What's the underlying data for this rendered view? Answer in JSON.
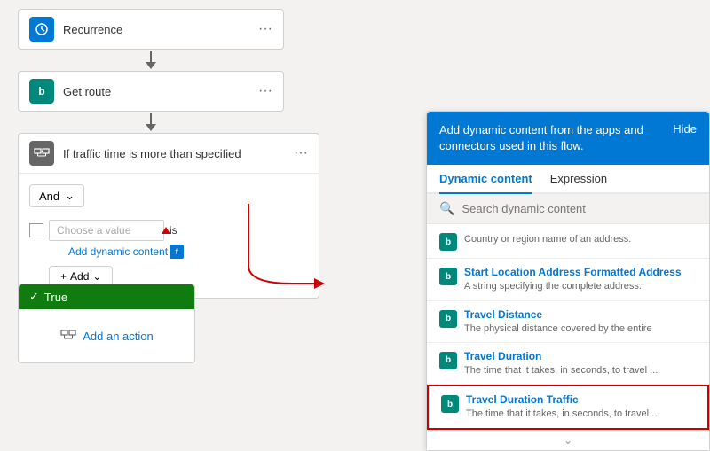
{
  "flow": {
    "blocks": [
      {
        "id": "recurrence",
        "title": "Recurrence",
        "iconType": "clock",
        "iconColor": "#0078d4"
      },
      {
        "id": "get-route",
        "title": "Get route",
        "iconType": "bing",
        "iconColor": "#00897b"
      },
      {
        "id": "condition",
        "title": "If traffic time is more than specified",
        "iconType": "condition",
        "iconColor": "#666"
      }
    ],
    "condition": {
      "and_label": "And",
      "choose_value_placeholder": "Choose a value",
      "is_label": "is",
      "add_dynamic_label": "Add dynamic content",
      "add_label": "Add"
    },
    "true_block": {
      "label": "True",
      "add_action_label": "Add an action"
    }
  },
  "dynamic_panel": {
    "header_text": "Add dynamic content from the apps and connectors used in this flow.",
    "hide_label": "Hide",
    "tabs": [
      {
        "label": "Dynamic content",
        "active": true
      },
      {
        "label": "Expression",
        "active": false
      }
    ],
    "search_placeholder": "Search dynamic content",
    "items": [
      {
        "id": "country-region",
        "title": "",
        "description": "Country or region name of an address.",
        "has_icon": true
      },
      {
        "id": "start-location",
        "title": "Start Location Address Formatted Address",
        "description": "A string specifying the complete address.",
        "has_icon": true
      },
      {
        "id": "travel-distance",
        "title": "Travel Distance",
        "description": "The physical distance covered by the entire",
        "has_icon": true,
        "selected": false
      },
      {
        "id": "travel-duration",
        "title": "Travel Duration",
        "description": "The time that it takes, in seconds, to travel ...",
        "has_icon": true,
        "selected": false
      },
      {
        "id": "travel-duration-traffic",
        "title": "Travel Duration Traffic",
        "description": "The time that it takes, in seconds, to travel ...",
        "has_icon": true,
        "selected": true
      }
    ]
  }
}
